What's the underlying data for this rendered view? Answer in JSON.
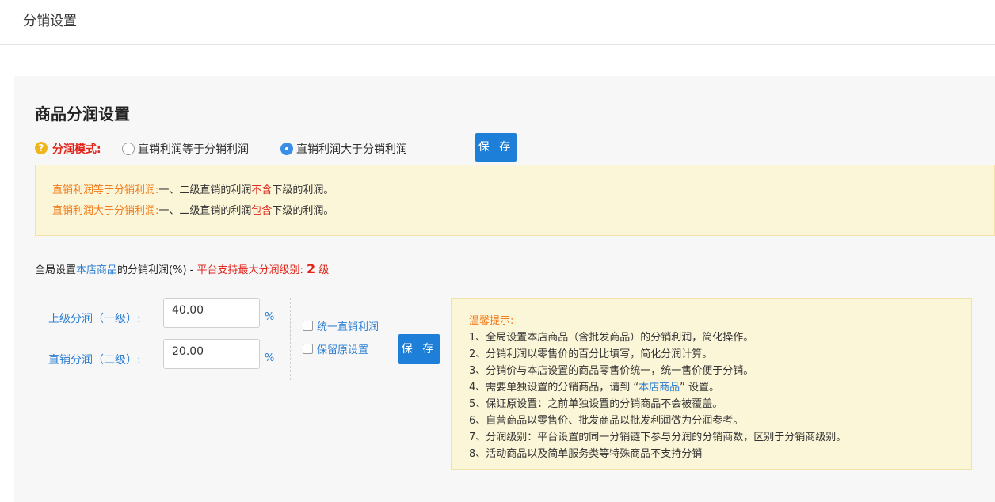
{
  "page": {
    "title": "分销设置"
  },
  "section": {
    "title": "商品分润设置"
  },
  "mode": {
    "label": "分润模式:",
    "option_equal": "直销利润等于分销利润",
    "option_greater": "直销利润大于分销利润",
    "selected": "option_greater",
    "save_label": "保 存"
  },
  "notice": {
    "line1": {
      "prefix": "直销利润等于分销利润:",
      "text_a": "一、二级直销的利润",
      "highlight": "不含",
      "text_b": "下级的利润。"
    },
    "line2": {
      "prefix": "直销利润大于分销利润:",
      "text_a": "一、二级直销的利润",
      "highlight": "包含",
      "text_b": "下级的利润。"
    }
  },
  "global": {
    "text_a": "全局设置",
    "link": "本店商品",
    "text_b": "的分销利润(%) - ",
    "platform_text": "平台支持最大分润级别:",
    "level": "2",
    "level_unit": "级"
  },
  "form": {
    "level1_label": "上级分润（一级）:",
    "level1_value": "40.00",
    "level2_label": "直销分润（二级）:",
    "level2_value": "20.00",
    "percent": "%",
    "unify_label": "统一直销利润",
    "keep_label": "保留原设置",
    "save_label": "保 存"
  },
  "tips": {
    "title": "温馨提示:",
    "item1": "1、全局设置本店商品（含批发商品）的分销利润，简化操作。",
    "item2": "2、分销利润以零售价的百分比填写，简化分润计算。",
    "item3": "3、分销价与本店设置的商品零售价统一，统一售价便于分销。",
    "item4_a": "4、需要单独设置的分销商品，请到 “",
    "item4_link": "本店商品",
    "item4_b": "” 设置。",
    "item5": "5、保证原设置：之前单独设置的分销商品不会被覆盖。",
    "item6": "6、自营商品以零售价、批发商品以批发利润做为分润参考。",
    "item7": "7、分润级别：平台设置的同一分销链下参与分润的分销商数，区别于分销商级别。",
    "item8": "8、活动商品以及简单服务类等特殊商品不支持分销"
  },
  "colors": {
    "accent": "#1e7fd8",
    "warning": "#e1251b",
    "notice_bg": "#fcf6d8",
    "link": "#2d7fd3",
    "orange": "#f27b1b"
  }
}
